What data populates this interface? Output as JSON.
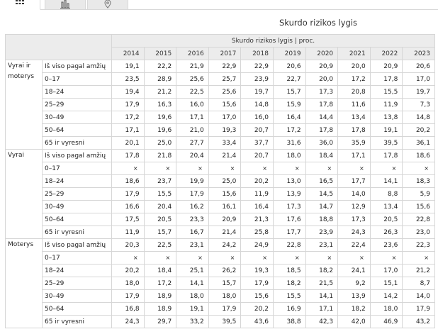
{
  "tabs": [
    {
      "name": "table-view-tab",
      "icon": "grid-icon",
      "active": true
    },
    {
      "name": "chart-view-tab",
      "icon": "bar-chart-icon",
      "active": false
    },
    {
      "name": "map-view-tab",
      "icon": "map-pin-icon",
      "active": false
    }
  ],
  "title": "Skurdo rizikos lygis",
  "table": {
    "header": "Skurdo rizikos lygis | proc.",
    "years": [
      "2014",
      "2015",
      "2016",
      "2017",
      "2018",
      "2019",
      "2020",
      "2021",
      "2022",
      "2023"
    ],
    "groups": [
      {
        "label": "Vyrai ir moterys",
        "rows": [
          {
            "sub": "Iš viso pagal amžių",
            "values": [
              "19,1",
              "22,2",
              "21,9",
              "22,9",
              "22,9",
              "20,6",
              "20,9",
              "20,0",
              "20,9",
              "20,6"
            ]
          },
          {
            "sub": "0–17",
            "values": [
              "23,5",
              "28,9",
              "25,6",
              "25,7",
              "23,9",
              "22,7",
              "20,0",
              "17,2",
              "17,8",
              "17,0"
            ]
          },
          {
            "sub": "18–24",
            "values": [
              "19,4",
              "21,2",
              "22,5",
              "25,6",
              "19,7",
              "15,7",
              "17,3",
              "20,8",
              "15,5",
              "19,7"
            ]
          },
          {
            "sub": "25–29",
            "values": [
              "17,9",
              "16,3",
              "16,0",
              "15,6",
              "14,8",
              "15,9",
              "17,8",
              "11,6",
              "11,9",
              "7,3"
            ]
          },
          {
            "sub": "30–49",
            "values": [
              "17,2",
              "19,6",
              "17,1",
              "17,0",
              "16,0",
              "16,4",
              "14,4",
              "13,4",
              "13,8",
              "14,8"
            ]
          },
          {
            "sub": "50–64",
            "values": [
              "17,1",
              "19,6",
              "21,0",
              "19,3",
              "20,7",
              "17,2",
              "17,8",
              "17,8",
              "19,1",
              "20,2"
            ]
          },
          {
            "sub": "65 ir vyresni",
            "values": [
              "20,1",
              "25,0",
              "27,7",
              "33,4",
              "37,7",
              "31,6",
              "36,0",
              "35,9",
              "39,5",
              "36,1"
            ]
          }
        ]
      },
      {
        "label": "Vyrai",
        "rows": [
          {
            "sub": "Iš viso pagal amžių",
            "values": [
              "17,8",
              "21,8",
              "20,4",
              "21,4",
              "20,7",
              "18,0",
              "18,4",
              "17,1",
              "17,8",
              "18,6"
            ]
          },
          {
            "sub": "0–17",
            "values": [
              "×",
              "×",
              "×",
              "×",
              "×",
              "×",
              "×",
              "×",
              "×",
              "×"
            ]
          },
          {
            "sub": "18–24",
            "values": [
              "18,6",
              "23,7",
              "19,9",
              "25,0",
              "20,2",
              "13,0",
              "16,5",
              "17,7",
              "14,1",
              "18,3"
            ]
          },
          {
            "sub": "25–29",
            "values": [
              "17,9",
              "15,5",
              "17,9",
              "15,6",
              "11,9",
              "13,9",
              "14,5",
              "14,0",
              "8,8",
              "5,9"
            ]
          },
          {
            "sub": "30–49",
            "values": [
              "16,6",
              "20,4",
              "16,2",
              "16,1",
              "16,4",
              "17,3",
              "14,7",
              "12,9",
              "13,4",
              "15,6"
            ]
          },
          {
            "sub": "50–64",
            "values": [
              "17,5",
              "20,5",
              "23,3",
              "20,9",
              "21,3",
              "17,6",
              "18,8",
              "17,3",
              "20,5",
              "22,8"
            ]
          },
          {
            "sub": "65 ir vyresni",
            "values": [
              "11,9",
              "15,7",
              "16,7",
              "21,4",
              "25,8",
              "17,7",
              "23,9",
              "24,3",
              "26,3",
              "23,0"
            ]
          }
        ]
      },
      {
        "label": "Moterys",
        "rows": [
          {
            "sub": "Iš viso pagal amžių",
            "values": [
              "20,3",
              "22,5",
              "23,1",
              "24,2",
              "24,9",
              "22,8",
              "23,1",
              "22,4",
              "23,6",
              "22,3"
            ]
          },
          {
            "sub": "0–17",
            "values": [
              "×",
              "×",
              "×",
              "×",
              "×",
              "×",
              "×",
              "×",
              "×",
              "×"
            ]
          },
          {
            "sub": "18–24",
            "values": [
              "20,2",
              "18,4",
              "25,1",
              "26,2",
              "19,3",
              "18,5",
              "18,2",
              "24,1",
              "17,0",
              "21,2"
            ]
          },
          {
            "sub": "25–29",
            "values": [
              "18,0",
              "17,2",
              "14,1",
              "15,7",
              "17,9",
              "18,2",
              "21,5",
              "9,2",
              "15,1",
              "8,7"
            ]
          },
          {
            "sub": "30–49",
            "values": [
              "17,9",
              "18,9",
              "18,0",
              "18,0",
              "15,6",
              "15,5",
              "14,1",
              "13,9",
              "14,2",
              "14,0"
            ]
          },
          {
            "sub": "50–64",
            "values": [
              "16,8",
              "18,9",
              "19,1",
              "17,9",
              "20,2",
              "16,9",
              "17,1",
              "18,2",
              "18,0",
              "17,9"
            ]
          },
          {
            "sub": "65 ir vyresni",
            "values": [
              "24,3",
              "29,7",
              "33,2",
              "39,5",
              "43,6",
              "38,8",
              "42,3",
              "42,0",
              "46,9",
              "43,2"
            ]
          }
        ]
      }
    ]
  }
}
